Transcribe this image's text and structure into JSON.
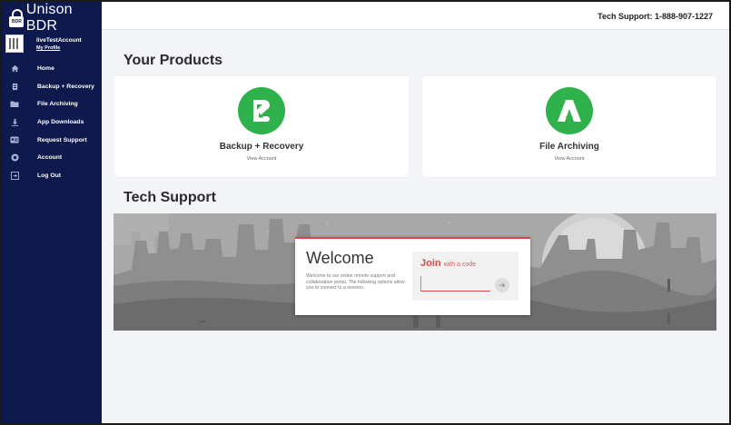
{
  "app": {
    "name": "Unison BDR",
    "lock_text": "BDR"
  },
  "user": {
    "name": "liveTestAccount",
    "profile_link": "My Profile"
  },
  "sidebar": {
    "items": [
      {
        "label": "Home",
        "icon": "home-icon"
      },
      {
        "label": "Backup + Recovery",
        "icon": "backup-icon"
      },
      {
        "label": "File Archiving",
        "icon": "folder-icon"
      },
      {
        "label": "App Downloads",
        "icon": "download-icon"
      },
      {
        "label": "Request Support",
        "icon": "support-icon"
      },
      {
        "label": "Account",
        "icon": "account-icon"
      },
      {
        "label": "Log Out",
        "icon": "logout-icon"
      }
    ]
  },
  "header": {
    "tech_support": "Tech Support: 1-888-907-1227"
  },
  "products": {
    "title": "Your Products",
    "items": [
      {
        "name": "Backup + Recovery",
        "link": "View Account",
        "icon": "backup-recovery-logo-icon"
      },
      {
        "name": "File Archiving",
        "link": "View Account",
        "icon": "file-archiving-logo-icon"
      }
    ]
  },
  "tech_support": {
    "title": "Tech Support",
    "welcome_title": "Welcome",
    "welcome_body": "Welcome to our online remote support and collaboration portal. The following options allow you to connect to a session.",
    "join_label": "Join",
    "join_suffix": "with a code",
    "join_value": "",
    "join_button_icon": "arrow-right-icon"
  },
  "colors": {
    "sidebar": "#0e1a4d",
    "product_green": "#2fb24c",
    "join_red": "#d84a4a"
  }
}
